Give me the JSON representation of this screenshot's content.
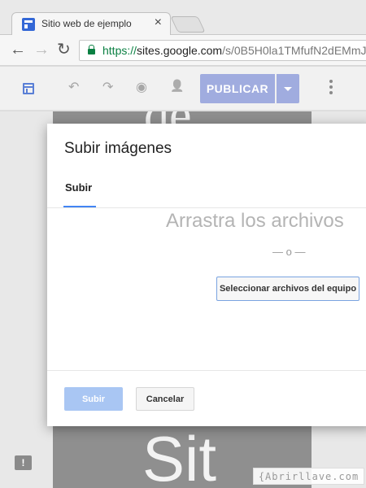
{
  "browser": {
    "tab_title": "Sitio web de ejemplo",
    "tab_close": "×",
    "url_scheme": "https://",
    "url_host": "sites.google.com",
    "url_path": "/s/0B5H0la1TMfufN2dEMmJ",
    "back": "←",
    "forward": "→",
    "reload": "↻"
  },
  "toolbar": {
    "undo": "↶",
    "redo": "↷",
    "preview": "◉",
    "share": "👤",
    "publish_label": "PUBLICAR"
  },
  "page": {
    "hero_top": "de",
    "hero_bottom": "Sit",
    "feedback": "!"
  },
  "dialog": {
    "title": "Subir imágenes",
    "tab_label": "Subir",
    "drop_text": "Arrastra los archivos",
    "or_text": "— o —",
    "select_button": "Seleccionar archivos del equipo",
    "upload_button": "Subir",
    "cancel_button": "Cancelar"
  },
  "watermark": "{Abrirllave.com"
}
